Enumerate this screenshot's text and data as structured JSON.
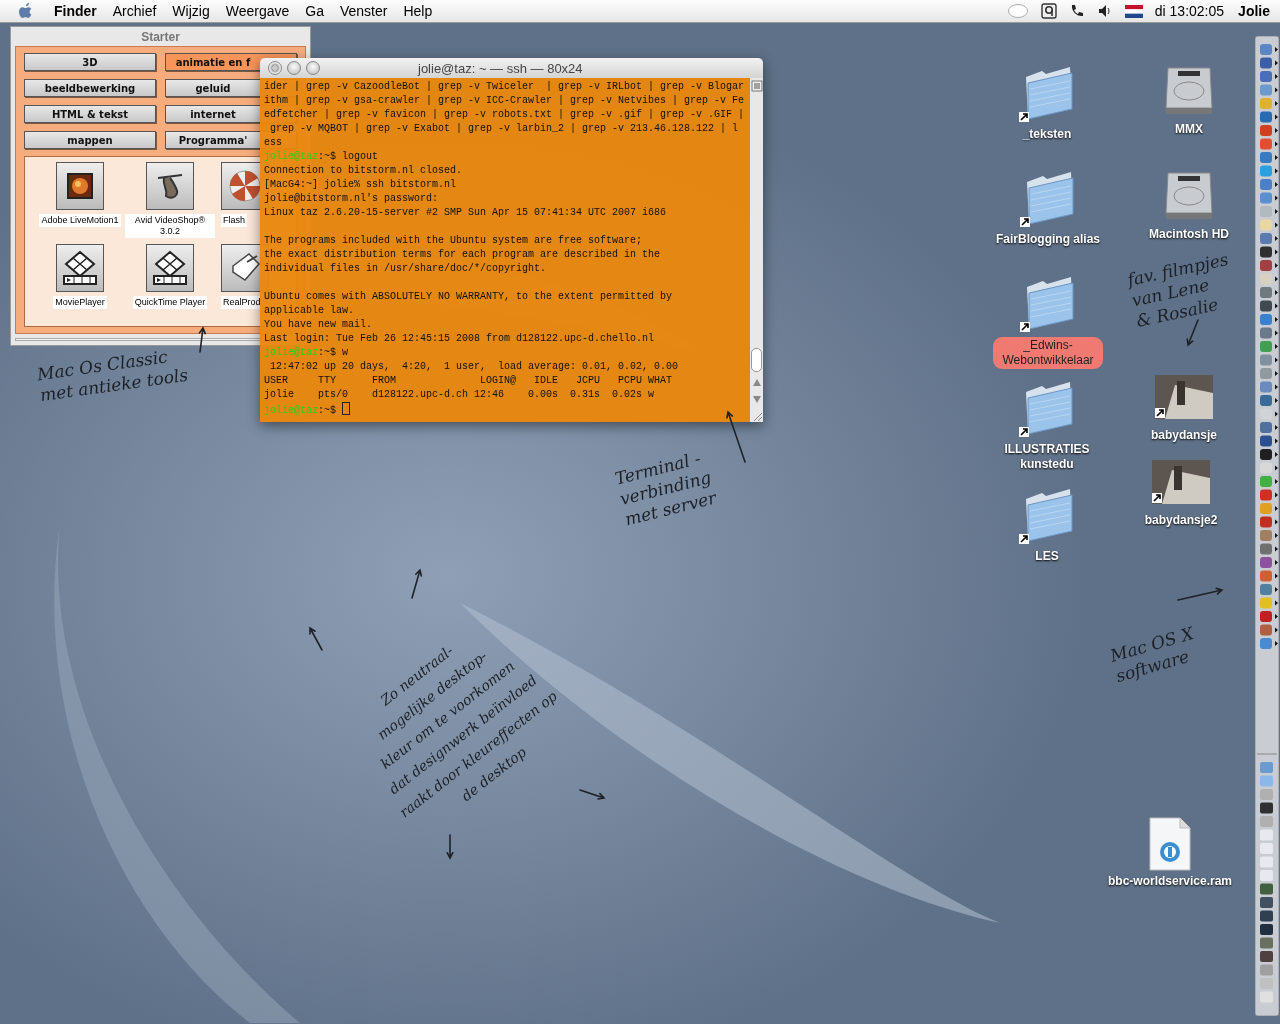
{
  "menu_bar": {
    "app": "Finder",
    "menus": [
      "Archief",
      "Wijzig",
      "Weergave",
      "Ga",
      "Venster",
      "Help"
    ],
    "clock": "di 13:02:05",
    "user": "Jolie"
  },
  "starter": {
    "title": "Starter",
    "categories": [
      {
        "label": "3D",
        "selected": false
      },
      {
        "label": "animatie en f",
        "selected": true
      },
      {
        "label": "beeldbewerking",
        "selected": false
      },
      {
        "label": "geluid",
        "selected": false
      },
      {
        "label": "HTML & tekst",
        "selected": false
      },
      {
        "label": "internet",
        "selected": false
      },
      {
        "label": "mappen",
        "selected": false
      },
      {
        "label": "Programma'",
        "selected": false
      }
    ],
    "apps": [
      {
        "name": "Adobe LiveMotion1",
        "kind": "picture"
      },
      {
        "name": "Avid VideoShop® 3.0.2",
        "kind": "figure"
      },
      {
        "name": "Flash",
        "kind": "pinwheel"
      },
      {
        "name": "MoviePlayer",
        "kind": "film"
      },
      {
        "name": "QuickTime Player",
        "kind": "film"
      },
      {
        "name": "RealProd",
        "kind": "document"
      }
    ]
  },
  "terminal": {
    "title": "jolie@taz: ~ — ssh — 80x24",
    "lines": [
      {
        "kind": "output",
        "text": "ider | grep -v CazoodleBot | grep -v Twiceler  | grep -v IRLbot | grep -v Blogar"
      },
      {
        "kind": "output",
        "text": "ithm | grep -v gsa-crawler | grep -v ICC-Crawler | grep -v Netvibes | grep -v Fe"
      },
      {
        "kind": "output",
        "text": "edfetcher | grep -v favicon | grep -v robots.txt | grep -v .gif | grep -v .GIF |"
      },
      {
        "kind": "output",
        "text": " grep -v MQBOT | grep -v Exabot | grep -v larbin_2 | grep -v 213.46.128.122 | l"
      },
      {
        "kind": "output",
        "text": "ess"
      },
      {
        "kind": "prompt",
        "prompt": "jolie@taz",
        "text": ":~$ logout",
        "cursor": false
      },
      {
        "kind": "output",
        "text": "Connection to bitstorm.nl closed."
      },
      {
        "kind": "output",
        "text": "[MacG4:~] jolie% ssh bitstorm.nl"
      },
      {
        "kind": "output",
        "text": "jolie@bitstorm.nl's password:"
      },
      {
        "kind": "output",
        "text": "Linux taz 2.6.20-15-server #2 SMP Sun Apr 15 07:41:34 UTC 2007 i686"
      },
      {
        "kind": "blank"
      },
      {
        "kind": "output",
        "text": "The programs included with the Ubuntu system are free software;"
      },
      {
        "kind": "output",
        "text": "the exact distribution terms for each program are described in the"
      },
      {
        "kind": "output",
        "text": "individual files in /usr/share/doc/*/copyright."
      },
      {
        "kind": "blank"
      },
      {
        "kind": "output",
        "text": "Ubuntu comes with ABSOLUTELY NO WARRANTY, to the extent permitted by"
      },
      {
        "kind": "output",
        "text": "applicable law."
      },
      {
        "kind": "output",
        "text": "You have new mail."
      },
      {
        "kind": "output",
        "text": "Last login: Tue Feb 26 12:45:15 2008 from d128122.upc-d.chello.nl"
      },
      {
        "kind": "prompt",
        "prompt": "jolie@taz",
        "text": ":~$ w",
        "cursor": false
      },
      {
        "kind": "output",
        "text": " 12:47:02 up 20 days,  4:20,  1 user,  load average: 0.01, 0.02, 0.00"
      },
      {
        "kind": "output",
        "text": "USER     TTY      FROM              LOGIN@   IDLE   JCPU   PCPU WHAT"
      },
      {
        "kind": "output",
        "text": "jolie    pts/0    d128122.upc-d.ch 12:46    0.00s  0.31s  0.02s w"
      },
      {
        "kind": "prompt",
        "prompt": "jolie@taz",
        "text": ":~$ ",
        "cursor": true
      }
    ]
  },
  "desktop_items": [
    {
      "name": "_teksten",
      "kind": "folder",
      "alias": true
    },
    {
      "name": "MMX",
      "kind": "disk",
      "alias": false
    },
    {
      "name": "FairBlogging alias",
      "kind": "folder",
      "alias": true
    },
    {
      "name": "Macintosh HD",
      "kind": "disk",
      "alias": false
    },
    {
      "name": "_Edwins-Webontwikkelaar",
      "kind": "folder",
      "alias": true,
      "color": "#f07a72"
    },
    {
      "name": "babydansje",
      "kind": "movie",
      "alias": true
    },
    {
      "name": "ILLUSTRATIES kunstedu",
      "kind": "folder",
      "alias": true
    },
    {
      "name": "babydansje2",
      "kind": "movie",
      "alias": true
    },
    {
      "name": "LES",
      "kind": "folder",
      "alias": true
    },
    {
      "name": "bbc-worldservice.ram",
      "kind": "document",
      "alias": false
    }
  ],
  "annotations": [
    {
      "lines": [
        "Mac Os Classic",
        "met antieke tools"
      ]
    },
    {
      "lines": [
        "Terminal -",
        "verbinding",
        "met server"
      ]
    },
    {
      "lines": [
        "fav. filmpjes",
        "van Lene",
        "& Rosalie"
      ]
    },
    {
      "lines": [
        "Mac OS X",
        "software"
      ]
    },
    {
      "lines": [
        "Zo neutraal-",
        "mogelijke desktop-",
        "kleur om te voorkomen",
        "dat designwerk beïnvloed",
        "raakt door kleureffecten op",
        "de desktop"
      ]
    }
  ]
}
